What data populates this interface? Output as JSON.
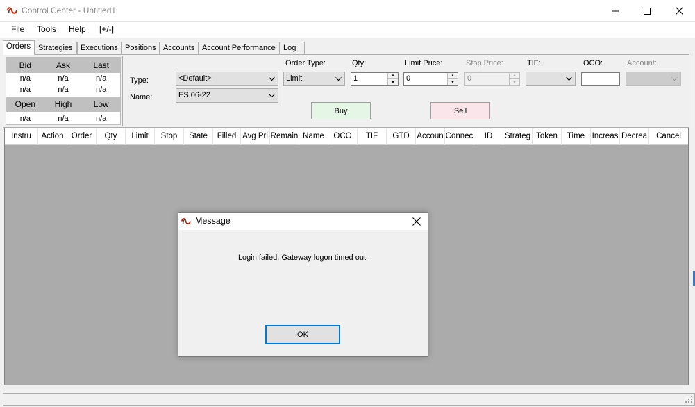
{
  "window": {
    "title": "Control Center - Untitled1"
  },
  "menu": {
    "items": [
      "File",
      "Tools",
      "Help",
      "[+/-]"
    ]
  },
  "tabs": [
    "Orders",
    "Strategies",
    "Executions",
    "Positions",
    "Accounts",
    "Account Performance",
    "Log"
  ],
  "quote": {
    "header1": [
      "Bid",
      "Ask",
      "Last"
    ],
    "row1": [
      "n/a",
      "n/a",
      "n/a"
    ],
    "row2": [
      "n/a",
      "n/a",
      "n/a"
    ],
    "header2": [
      "Open",
      "High",
      "Low"
    ],
    "row3": [
      "n/a",
      "n/a",
      "n/a"
    ]
  },
  "order_entry": {
    "type_label": "Type:",
    "type_value": "<Default>",
    "name_label": "Name:",
    "name_value": "ES 06-22",
    "order_type_label": "Order Type:",
    "order_type_value": "Limit",
    "qty_label": "Qty:",
    "qty_value": "1",
    "limit_price_label": "Limit Price:",
    "limit_price_value": "0",
    "stop_price_label": "Stop Price:",
    "stop_price_value": "0",
    "tif_label": "TIF:",
    "oco_label": "OCO:",
    "account_label": "Account:",
    "buy_label": "Buy",
    "sell_label": "Sell"
  },
  "grid": {
    "columns": [
      "Instru",
      "Action",
      "Order",
      "Qty",
      "Limit",
      "Stop",
      "State",
      "Filled",
      "Avg Pri",
      "Remain",
      "Name",
      "OCO",
      "TIF",
      "GTD",
      "Accoun",
      "Connec",
      "ID",
      "Strateg",
      "Token",
      "Time",
      "Increas",
      "Decrea",
      "Cancel"
    ]
  },
  "dialog": {
    "title": "Message",
    "message": "Login failed: Gateway logon timed out.",
    "ok_label": "OK"
  },
  "colors": {
    "buy_bg": "#e6f6e6",
    "sell_bg": "#fae6ea",
    "grid_bg": "#ababab",
    "focus_border": "#0078d7",
    "brand": "#cc2200"
  }
}
